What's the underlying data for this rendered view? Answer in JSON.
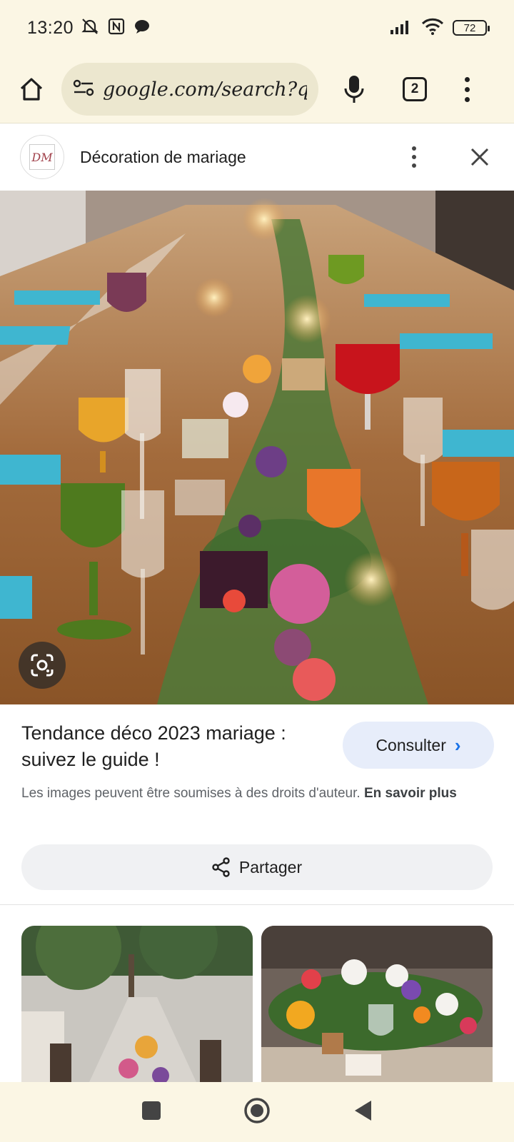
{
  "status_bar": {
    "time": "13:20",
    "battery": "72",
    "icons": [
      "mute-icon",
      "nfc-icon",
      "chat-bubble-icon",
      "signal-icon",
      "wifi-icon",
      "battery-icon"
    ]
  },
  "browser": {
    "url": "google.com/search?q=",
    "tab_count": "2",
    "icons": [
      "home-icon",
      "site-settings-icon",
      "microphone-icon",
      "overflow-menu-icon"
    ]
  },
  "source": {
    "logo_text": "DM",
    "name": "Décoration de mariage"
  },
  "result": {
    "title": "Tendance déco 2023 mariage : suivez le guide !",
    "visit_label": "Consulter",
    "copyright_text": "Les images peuvent être soumises à des droits d'auteur.",
    "learn_more_label": "En savoir plus",
    "share_label": "Partager"
  },
  "colors": {
    "background": "#fbf6e4",
    "url_bar": "#ece7cf",
    "visit_button": "#e7edfa",
    "accent": "#1a73e8"
  }
}
